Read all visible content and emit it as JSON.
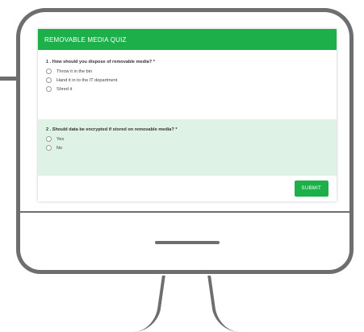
{
  "quiz": {
    "title": "REMOVABLE MEDIA QUIZ",
    "questions": [
      {
        "text": "1 . How should you dispose of removable media? *",
        "options": [
          "Throw it in the bin",
          "Hand it in to the IT department",
          "Shred it"
        ]
      },
      {
        "text": "2 . Should data be encrypted if stored on removable media? *",
        "options": [
          "Yes",
          "No"
        ]
      }
    ],
    "submit_label": "SUBMIT"
  },
  "colors": {
    "accent": "#1daf4a",
    "question_bg": "#dff2e6",
    "frame": "#6e6e6e"
  }
}
